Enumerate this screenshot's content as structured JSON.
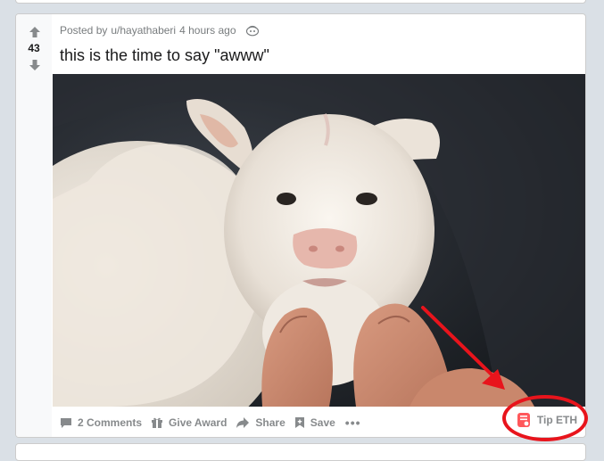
{
  "post": {
    "vote_count": "43",
    "posted_by_prefix": "Posted by",
    "username": "u/hayathaberi",
    "time_ago": "4 hours ago",
    "title": "this is the time to say \"awww\""
  },
  "actions": {
    "comments_label": "2 Comments",
    "award_label": "Give Award",
    "share_label": "Share",
    "save_label": "Save",
    "more_label": "•••",
    "tip_label": "Tip ETH"
  },
  "icons": {
    "upvote": "arrow-up-icon",
    "downvote": "arrow-down-icon",
    "comments": "comment-icon",
    "award": "gift-icon",
    "share": "share-arrow-icon",
    "save": "bookmark-icon",
    "tip": "eth-tip-icon",
    "meta": "stream-icon"
  },
  "colors": {
    "accent_red": "#e8141c",
    "action_gray": "#878a8c",
    "tip_icon": "#ff585b"
  }
}
